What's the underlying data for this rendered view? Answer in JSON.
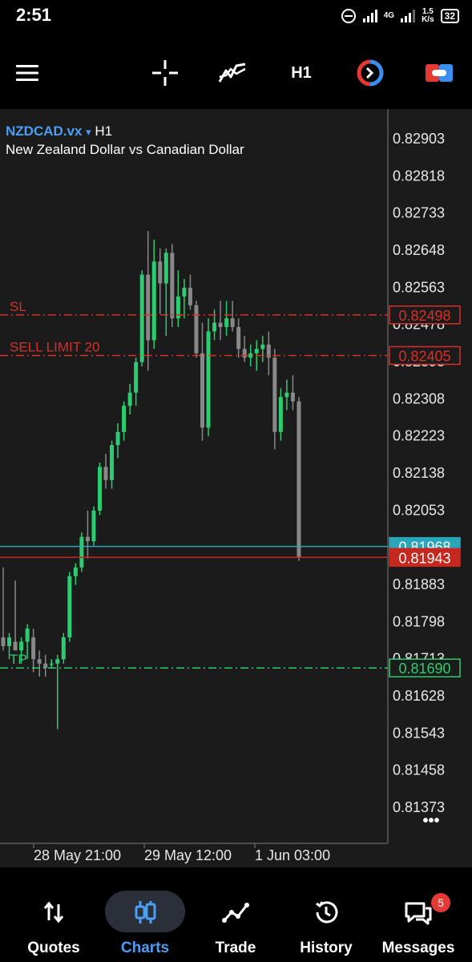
{
  "status_bar": {
    "time": "2:51",
    "network": "4G",
    "speed_value": "1.5",
    "speed_unit": "K/s",
    "battery": "32"
  },
  "toolbar": {
    "timeframe": "H1"
  },
  "chart_header": {
    "symbol": "NZDCAD.vx",
    "symbol_caret": "▾",
    "timeframe": "H1",
    "description": "New Zealand Dollar vs Canadian Dollar"
  },
  "chart_data": {
    "type": "candlestick",
    "y_ticks": [
      "0.82903",
      "0.82818",
      "0.82733",
      "0.82648",
      "0.82563",
      "0.82478",
      "0.82393",
      "0.82308",
      "0.82223",
      "0.82138",
      "0.82053",
      "0.81968",
      "0.81883",
      "0.81798",
      "0.81713",
      "0.81628",
      "0.81543",
      "0.81458",
      "0.81373"
    ],
    "x_ticks": [
      "28 May 21:00",
      "29 May 12:00",
      "1 Jun 03:00"
    ],
    "ylim": [
      0.8133,
      0.8297
    ],
    "levels": [
      {
        "name": "SL",
        "label": "SL",
        "price": "0.82498",
        "color": "#d6302a",
        "style": "dashdot"
      },
      {
        "name": "sell-limit",
        "label": "SELL LIMIT 20",
        "price": "0.82405",
        "color": "#d6302a",
        "style": "dashdot"
      },
      {
        "name": "ask",
        "label": "",
        "price": "0.81968",
        "color": "#29a6b9",
        "style": "solid"
      },
      {
        "name": "bid",
        "label": "",
        "price": "0.81943",
        "color": "#c6281f",
        "style": "solid"
      },
      {
        "name": "TP",
        "label": "TP",
        "price": "0.81690",
        "color": "#2ecc71",
        "style": "dashdot"
      }
    ],
    "candles": [
      {
        "o": 0.8176,
        "h": 0.8192,
        "l": 0.8173,
        "c": 0.8174
      },
      {
        "o": 0.8174,
        "h": 0.8177,
        "l": 0.8171,
        "c": 0.8176
      },
      {
        "o": 0.8175,
        "h": 0.8189,
        "l": 0.8174,
        "c": 0.8173
      },
      {
        "o": 0.8173,
        "h": 0.8176,
        "l": 0.817,
        "c": 0.8175
      },
      {
        "o": 0.8175,
        "h": 0.8179,
        "l": 0.8171,
        "c": 0.8178
      },
      {
        "o": 0.8176,
        "h": 0.8178,
        "l": 0.8168,
        "c": 0.8171
      },
      {
        "o": 0.8171,
        "h": 0.8173,
        "l": 0.8167,
        "c": 0.817
      },
      {
        "o": 0.817,
        "h": 0.8172,
        "l": 0.8167,
        "c": 0.8169
      },
      {
        "o": 0.817,
        "h": 0.8171,
        "l": 0.8169,
        "c": 0.817
      },
      {
        "o": 0.817,
        "h": 0.8172,
        "l": 0.8155,
        "c": 0.8171
      },
      {
        "o": 0.8171,
        "h": 0.8177,
        "l": 0.817,
        "c": 0.8176
      },
      {
        "o": 0.8176,
        "h": 0.8191,
        "l": 0.8175,
        "c": 0.819
      },
      {
        "o": 0.819,
        "h": 0.8193,
        "l": 0.8188,
        "c": 0.8192
      },
      {
        "o": 0.8192,
        "h": 0.82,
        "l": 0.8191,
        "c": 0.8199
      },
      {
        "o": 0.8199,
        "h": 0.8205,
        "l": 0.8194,
        "c": 0.8198
      },
      {
        "o": 0.8198,
        "h": 0.8206,
        "l": 0.8197,
        "c": 0.8205
      },
      {
        "o": 0.8205,
        "h": 0.8216,
        "l": 0.8204,
        "c": 0.8215
      },
      {
        "o": 0.8215,
        "h": 0.8218,
        "l": 0.821,
        "c": 0.8212
      },
      {
        "o": 0.8212,
        "h": 0.8221,
        "l": 0.821,
        "c": 0.822
      },
      {
        "o": 0.822,
        "h": 0.8225,
        "l": 0.8217,
        "c": 0.8223
      },
      {
        "o": 0.8223,
        "h": 0.823,
        "l": 0.8221,
        "c": 0.8229
      },
      {
        "o": 0.8229,
        "h": 0.8234,
        "l": 0.8227,
        "c": 0.8232
      },
      {
        "o": 0.8232,
        "h": 0.824,
        "l": 0.8229,
        "c": 0.8239
      },
      {
        "o": 0.8239,
        "h": 0.826,
        "l": 0.8238,
        "c": 0.8259
      },
      {
        "o": 0.8259,
        "h": 0.8269,
        "l": 0.8237,
        "c": 0.8244
      },
      {
        "o": 0.8244,
        "h": 0.8267,
        "l": 0.8242,
        "c": 0.8262
      },
      {
        "o": 0.8262,
        "h": 0.8265,
        "l": 0.825,
        "c": 0.8257
      },
      {
        "o": 0.8257,
        "h": 0.8265,
        "l": 0.8245,
        "c": 0.8264
      },
      {
        "o": 0.8264,
        "h": 0.8266,
        "l": 0.8247,
        "c": 0.8249
      },
      {
        "o": 0.8249,
        "h": 0.826,
        "l": 0.8247,
        "c": 0.8254
      },
      {
        "o": 0.8254,
        "h": 0.8258,
        "l": 0.8249,
        "c": 0.8256
      },
      {
        "o": 0.8256,
        "h": 0.8259,
        "l": 0.8251,
        "c": 0.8252
      },
      {
        "o": 0.8252,
        "h": 0.8253,
        "l": 0.824,
        "c": 0.8241
      },
      {
        "o": 0.8241,
        "h": 0.8248,
        "l": 0.8221,
        "c": 0.8224
      },
      {
        "o": 0.8224,
        "h": 0.8249,
        "l": 0.8222,
        "c": 0.8246
      },
      {
        "o": 0.8246,
        "h": 0.8251,
        "l": 0.8244,
        "c": 0.8248
      },
      {
        "o": 0.8248,
        "h": 0.8253,
        "l": 0.8244,
        "c": 0.8247
      },
      {
        "o": 0.8247,
        "h": 0.8253,
        "l": 0.8245,
        "c": 0.8249
      },
      {
        "o": 0.8249,
        "h": 0.8253,
        "l": 0.8246,
        "c": 0.8247
      },
      {
        "o": 0.8247,
        "h": 0.8249,
        "l": 0.824,
        "c": 0.8242
      },
      {
        "o": 0.8242,
        "h": 0.8245,
        "l": 0.8239,
        "c": 0.824
      },
      {
        "o": 0.824,
        "h": 0.8243,
        "l": 0.8238,
        "c": 0.8241
      },
      {
        "o": 0.8241,
        "h": 0.8244,
        "l": 0.8237,
        "c": 0.8242
      },
      {
        "o": 0.8242,
        "h": 0.8245,
        "l": 0.8239,
        "c": 0.8243
      },
      {
        "o": 0.8243,
        "h": 0.8246,
        "l": 0.8236,
        "c": 0.824
      },
      {
        "o": 0.824,
        "h": 0.8242,
        "l": 0.8219,
        "c": 0.8223
      },
      {
        "o": 0.8223,
        "h": 0.8233,
        "l": 0.8221,
        "c": 0.8231
      },
      {
        "o": 0.8231,
        "h": 0.8235,
        "l": 0.8228,
        "c": 0.8232
      },
      {
        "o": 0.8232,
        "h": 0.8236,
        "l": 0.8228,
        "c": 0.823
      },
      {
        "o": 0.823,
        "h": 0.8231,
        "l": 0.81935,
        "c": 0.81943
      }
    ]
  },
  "chart_menu": {
    "more": "•••"
  },
  "bottom_nav": [
    {
      "label": "Quotes",
      "icon": "up-down-arrows-icon"
    },
    {
      "label": "Charts",
      "icon": "candles-icon",
      "active": true
    },
    {
      "label": "Trade",
      "icon": "trend-line-icon"
    },
    {
      "label": "History",
      "icon": "history-clock-icon"
    },
    {
      "label": "Messages",
      "icon": "chat-bubbles-icon",
      "badge": "5"
    }
  ],
  "colors": {
    "bull": "#2ecc71",
    "bear": "#888888",
    "background": "#1b1b1b",
    "axis_text": "#e8e8e8",
    "accent_blue": "#4a9ff5"
  }
}
